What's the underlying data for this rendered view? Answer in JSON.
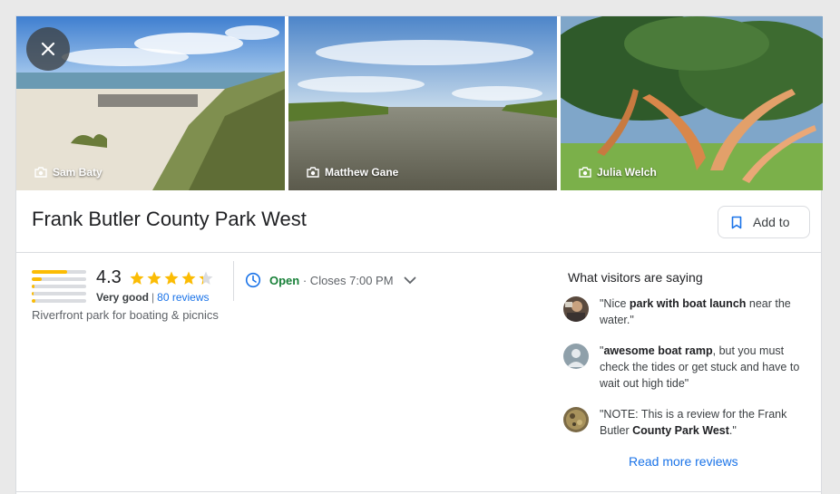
{
  "photos": [
    {
      "credit": "Sam Baty"
    },
    {
      "credit": "Matthew Gane"
    },
    {
      "credit": "Julia Welch"
    }
  ],
  "place": {
    "title": "Frank Butler County Park West",
    "add_label": "Add to",
    "description": "Riverfront park for boating & picnics"
  },
  "rating": {
    "value": "4.3",
    "stars_filled": 4.3,
    "label": "Very good",
    "separator": "|",
    "reviews_link": "80 reviews",
    "distribution": [
      0.65,
      0.18,
      0.05,
      0.04,
      0.06
    ]
  },
  "hours": {
    "status": "Open",
    "closes": "· Closes 7:00 PM"
  },
  "reviews": {
    "heading": "What visitors are saying",
    "items": [
      {
        "q1": "\"Nice ",
        "b1": "park with boat launch",
        "q2": " near the water.\"",
        "b2": "",
        "q3": ""
      },
      {
        "q1": "\"",
        "b1": "awesome boat ramp",
        "q2": ", but you must check the tides or get stuck and have to wait out high tide\"",
        "b2": "",
        "q3": ""
      },
      {
        "q1": "\"NOTE: This is a review for the Frank Butler ",
        "b1": "County Park West",
        "q2": ".\"",
        "b2": "",
        "q3": ""
      }
    ],
    "more_label": "Read more reviews"
  },
  "colors": {
    "star": "#fbbc04",
    "link": "#1a73e8",
    "open": "#188038"
  }
}
